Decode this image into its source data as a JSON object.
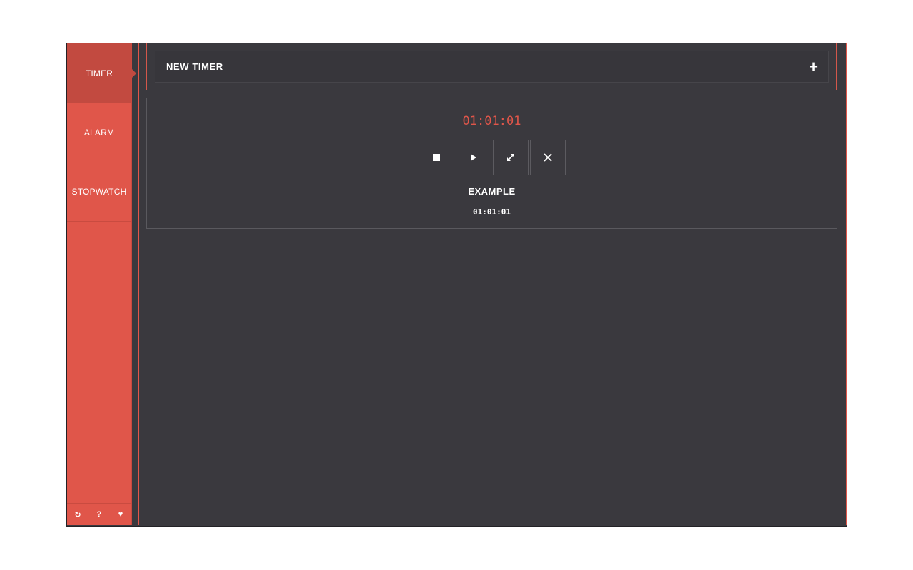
{
  "sidebar": {
    "items": [
      {
        "label": "TIMER",
        "active": true
      },
      {
        "label": "ALARM",
        "active": false
      },
      {
        "label": "STOPWATCH",
        "active": false
      }
    ],
    "footer": [
      {
        "icon": "refresh-icon",
        "glyph": "↻"
      },
      {
        "icon": "help-icon",
        "glyph": "?"
      },
      {
        "icon": "heart-icon",
        "glyph": "♥"
      }
    ]
  },
  "new_timer": {
    "label": "NEW TIMER",
    "icon": "plus-icon",
    "glyph": "+"
  },
  "timer": {
    "remaining": "01:01:01",
    "name": "EXAMPLE",
    "duration": "01:01:01",
    "controls": [
      "stop-icon",
      "play-icon",
      "expand-icon",
      "close-icon"
    ]
  },
  "colors": {
    "accent": "#e0564a",
    "accent_dark": "#c24a40",
    "background": "#3a393e",
    "text": "#ffffff"
  }
}
